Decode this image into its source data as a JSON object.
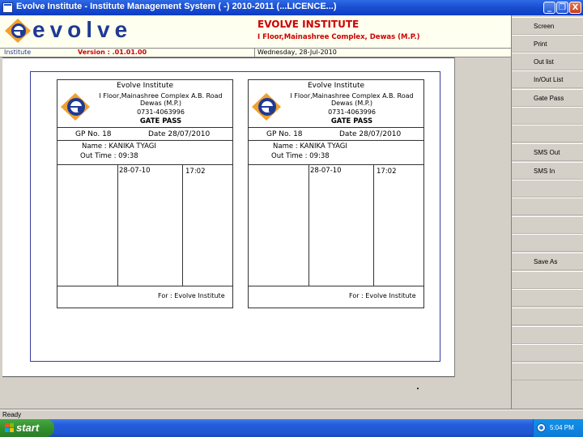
{
  "window": {
    "title": "Evolve Institute - Institute Management System ( -) 2010-2011 (...LICENCE...)",
    "minimize_glyph": "_",
    "restore_glyph": "❐",
    "close_glyph": "X"
  },
  "header": {
    "logo_word": "evolve",
    "institute_name": "EVOLVE INSTITUTE",
    "address": "I Floor,Mainashree Complex, Dewas (M.P.)"
  },
  "infobar": {
    "label": "Institute",
    "version": "Version : .01.01.00",
    "date": "Wednesday, 28-Jul-2010"
  },
  "side_buttons": [
    "Screen",
    "Print",
    "Out list",
    "In/Out List",
    "Gate Pass",
    "",
    "",
    "SMS Out",
    "SMS In",
    "",
    "",
    "",
    "",
    "Save As",
    "",
    "",
    "",
    "",
    "",
    ""
  ],
  "pass": {
    "institute": "Evolve Institute",
    "address_line1": "I Floor,Mainashree Complex A.B. Road",
    "address_line2": "Dewas (M.P.)",
    "phone": "0731-4063996",
    "heading": "GATE PASS",
    "gp_no": "GP No. 18",
    "date": "Date 28/07/2010",
    "name": "Name : KANIKA  TYAGI",
    "out_time": "Out Time : 09:38",
    "row_date": "28-07-10",
    "row_time": "17:02",
    "footer": "For  :  Evolve Institute"
  },
  "status": {
    "text": "Ready"
  },
  "taskbar": {
    "start_label": "start",
    "clock": "5:04 PM"
  },
  "colors": {
    "brand_blue": "#1f3a94",
    "brand_red": "#cc0000",
    "logo_orange": "#f0a030"
  }
}
